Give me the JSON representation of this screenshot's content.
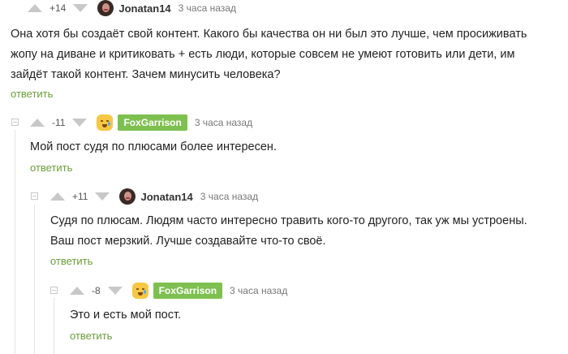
{
  "colors": {
    "reply": "#6a9e3a",
    "badge": "#7ec050",
    "arrow": "#c8c8c8",
    "thread": "#e4e4e4"
  },
  "comments": [
    {
      "rating": "+14",
      "author": "Jonatan14",
      "avatar": "woman-photo-avatar",
      "time": "3 часа назад",
      "text_lines": [
        "Она хотя бы создаёт свой контент. Какого бы качества он ни был это лучше, чем просиживать",
        "жопу на диване и критиковать  + есть люди, которые совсем не умеют готовить или дети, им",
        "зайдёт такой контент. Зачем минусить человека?"
      ],
      "reply_label": "ответить"
    },
    {
      "rating": "-11",
      "author": "FoxGarrison",
      "avatar": "crying-emoji-avatar",
      "time": "3 часа назад",
      "text_lines": [
        "Мой пост судя по плюсами более интересен."
      ],
      "reply_label": "ответить"
    },
    {
      "rating": "+11",
      "author": "Jonatan14",
      "avatar": "woman-photo-avatar",
      "time": "3 часа назад",
      "text_lines": [
        "Судя по плюсам. Людям часто интересно травить кого-то другого, так уж мы устроены.",
        "Ваш пост мерзкий. Лучше создавайте что-то своё."
      ],
      "reply_label": "ответить"
    },
    {
      "rating": "-8",
      "author": "FoxGarrison",
      "avatar": "crying-emoji-avatar",
      "time": "3 часа назад",
      "text_lines": [
        "Это и есть мой пост."
      ],
      "reply_label": "ответить"
    }
  ]
}
